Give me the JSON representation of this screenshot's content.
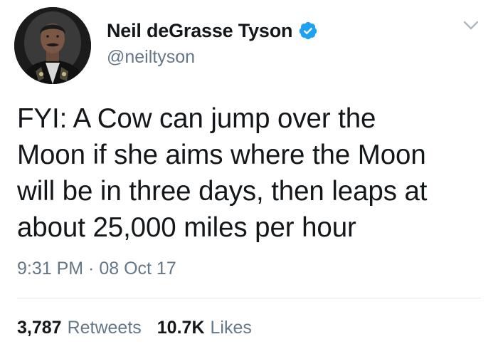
{
  "author": {
    "display_name": "Neil deGrasse Tyson",
    "handle": "@neiltyson",
    "verified": true
  },
  "icons": {
    "avatar": "profile-photo",
    "verified": "verified-badge-icon",
    "menu": "chevron-down-icon"
  },
  "tweet": {
    "text": "FYI: A Cow can jump over the\nMoon if she aims where the Moon\nwill be in three days, then leaps at\nabout 25,000 miles per hour",
    "timestamp": "9:31 PM · 08 Oct 17"
  },
  "stats": {
    "retweets_count": "3,787",
    "retweets_label": "Retweets",
    "likes_count": "10.7K",
    "likes_label": "Likes"
  },
  "colors": {
    "text": "#14171a",
    "secondary": "#657786",
    "verified_blue": "#1da1f2",
    "divider": "#e1e8ed"
  }
}
